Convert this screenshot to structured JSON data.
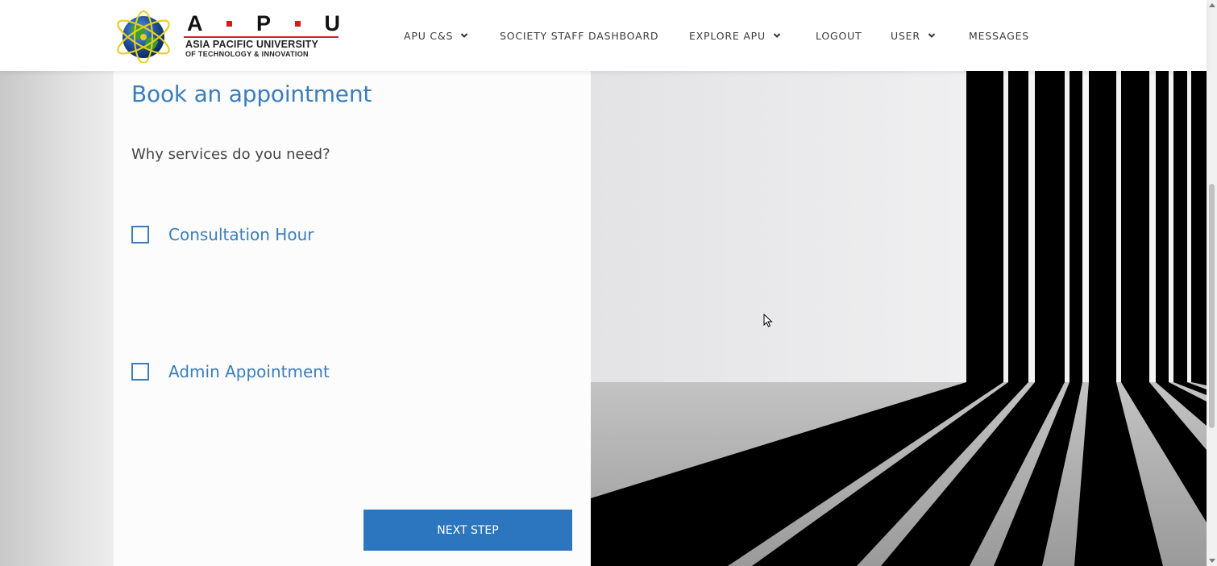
{
  "brand": {
    "logo_letters": [
      "A",
      "P",
      "U"
    ],
    "line1": "ASIA PACIFIC UNIVERSITY",
    "line2": "OF TECHNOLOGY & INNOVATION",
    "accent_color": "#c2262b"
  },
  "nav": {
    "items": [
      {
        "label": "APU C&S",
        "has_dropdown": true
      },
      {
        "label": "SOCIETY STAFF DASHBOARD",
        "has_dropdown": false
      },
      {
        "label": "EXPLORE APU",
        "has_dropdown": true
      },
      {
        "label": "LOGOUT",
        "has_dropdown": false
      },
      {
        "label": "USER",
        "has_dropdown": true
      },
      {
        "label": "MESSAGES",
        "has_dropdown": false
      }
    ]
  },
  "form": {
    "title": "Book an appointment",
    "question": "Why services do you need?",
    "options": [
      {
        "label": "Consultation Hour",
        "checked": false
      },
      {
        "label": "Admin Appointment",
        "checked": false
      }
    ],
    "next_label": "NEXT STEP"
  },
  "colors": {
    "primary_blue": "#3a7dbd",
    "button_blue": "#2c76bf"
  }
}
